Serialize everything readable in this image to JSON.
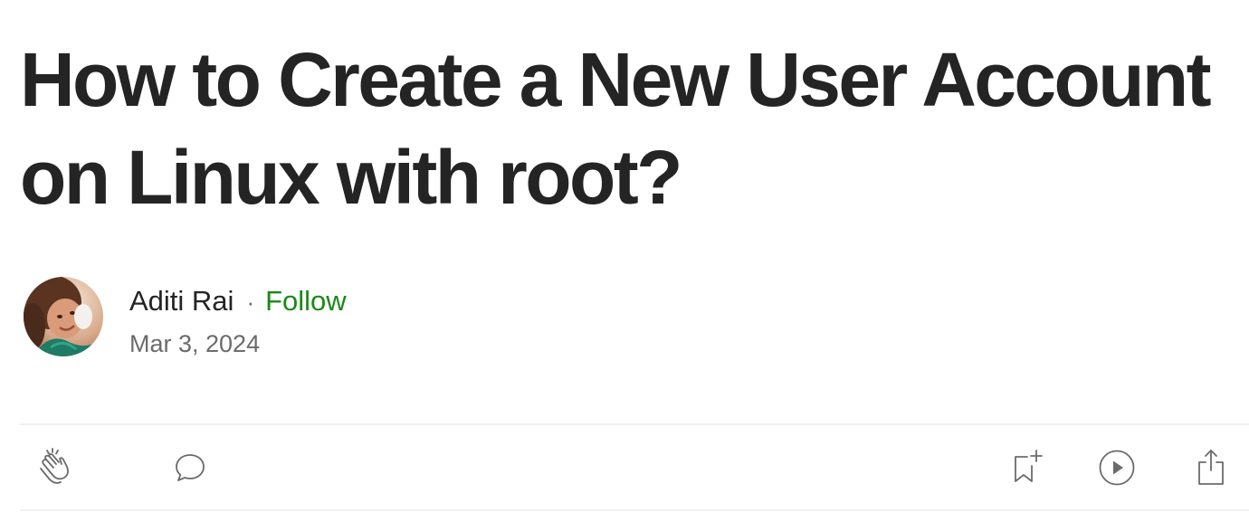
{
  "article": {
    "title": "How to Create a New User Account on Linux with root?"
  },
  "author": {
    "name": "Aditi Rai",
    "separator": "·",
    "follow_label": "Follow",
    "published_date": "Mar 3, 2024"
  },
  "colors": {
    "text": "#242424",
    "muted": "#6b6b6b",
    "follow_green": "#1a8917",
    "divider": "#f0f0f0"
  },
  "actions": {
    "left": [
      "clap-icon",
      "comment-icon"
    ],
    "right": [
      "bookmark-add-icon",
      "play-icon",
      "share-icon"
    ]
  }
}
